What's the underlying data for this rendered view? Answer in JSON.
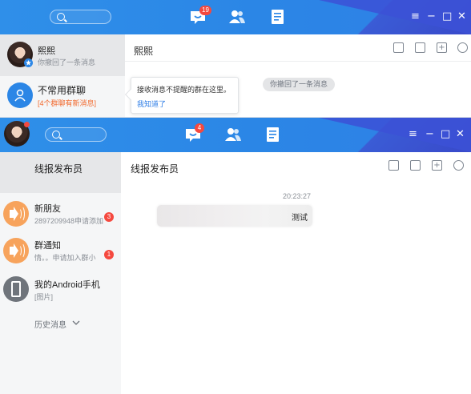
{
  "window_back": {
    "nav_badge": "19",
    "contact": {
      "name": "熙熙",
      "preview": "你撤回了一条消息"
    },
    "group_folder": {
      "name": "不常用群聊",
      "notice": "[4个群聊有新消息]"
    },
    "tooltip": {
      "text": "接收消息不提醒的群在这里。",
      "link": "我知道了"
    },
    "chat_title": "熙熙",
    "system_message": "你撤回了一条消息"
  },
  "window_front": {
    "nav_badge": "4",
    "list_header": "线报发布员",
    "list": [
      {
        "name": "新朋友",
        "preview": "2897209948申请添加",
        "badge": "3"
      },
      {
        "name": "群通知",
        "preview": "情。。申请加入群小",
        "badge": "1"
      },
      {
        "name": "我的Android手机",
        "preview": "[图片]"
      }
    ],
    "history_label": "历史消息",
    "chat_title": "线报发布员",
    "timestamp": "20:23:27",
    "message_text": "测试"
  },
  "colors": {
    "titlebar": "#2b86e6",
    "titlebar_accent": "#3c51d6",
    "badge": "#f5493f",
    "orange_icon": "#f7a35c",
    "link": "#2c7ce6",
    "notice": "#f26a2e"
  },
  "icons": [
    "search-icon",
    "messages-icon",
    "contacts-icon",
    "notes-icon",
    "menu-icon",
    "minimize-icon",
    "maximize-icon",
    "close-icon",
    "screenshot-icon",
    "phone-icon",
    "add-icon",
    "settings-icon",
    "group-icon",
    "speaker-icon",
    "phone-device-icon",
    "chevron-down-icon"
  ]
}
